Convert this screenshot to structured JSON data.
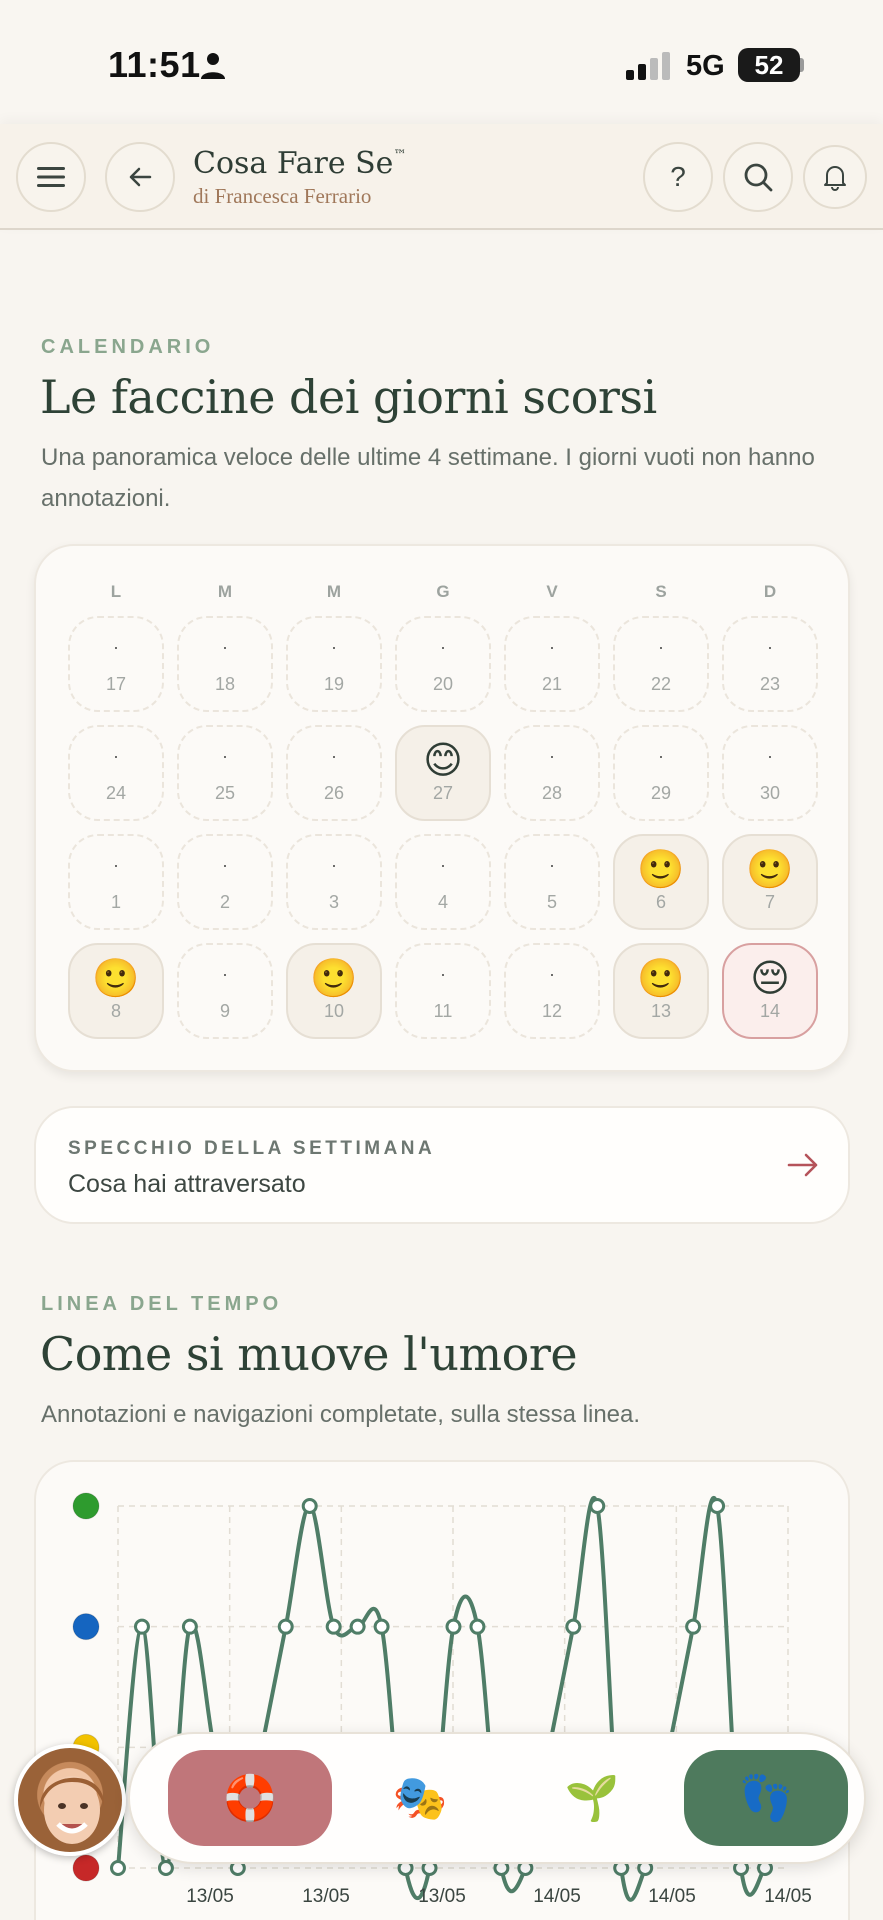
{
  "status_bar": {
    "time": "11:51",
    "network": "5G",
    "battery": "52"
  },
  "header": {
    "title": "Cosa Fare Se",
    "trademark": "™",
    "subtitle": "di Francesca Ferrario",
    "help_label": "?"
  },
  "calendar": {
    "eyebrow": "CALENDARIO",
    "title": "Le faccine dei giorni scorsi",
    "description": "Una panoramica veloce delle ultime 4 settimane. I giorni vuoti non hanno annotazioni.",
    "weekdays": [
      "L",
      "M",
      "M",
      "G",
      "V",
      "S",
      "D"
    ],
    "weeks": [
      [
        {
          "day": "17",
          "mood": "·"
        },
        {
          "day": "18",
          "mood": "·"
        },
        {
          "day": "19",
          "mood": "·"
        },
        {
          "day": "20",
          "mood": "·"
        },
        {
          "day": "21",
          "mood": "·"
        },
        {
          "day": "22",
          "mood": "·"
        },
        {
          "day": "23",
          "mood": "·"
        }
      ],
      [
        {
          "day": "24",
          "mood": "·"
        },
        {
          "day": "25",
          "mood": "·"
        },
        {
          "day": "26",
          "mood": "·"
        },
        {
          "day": "27",
          "mood": "😊"
        },
        {
          "day": "28",
          "mood": "·"
        },
        {
          "day": "29",
          "mood": "·"
        },
        {
          "day": "30",
          "mood": "·"
        }
      ],
      [
        {
          "day": "1",
          "mood": "·"
        },
        {
          "day": "2",
          "mood": "·"
        },
        {
          "day": "3",
          "mood": "·"
        },
        {
          "day": "4",
          "mood": "·"
        },
        {
          "day": "5",
          "mood": "·"
        },
        {
          "day": "6",
          "mood": "🙂"
        },
        {
          "day": "7",
          "mood": "🙂"
        }
      ],
      [
        {
          "day": "8",
          "mood": "🙂"
        },
        {
          "day": "9",
          "mood": "·"
        },
        {
          "day": "10",
          "mood": "🙂"
        },
        {
          "day": "11",
          "mood": "·"
        },
        {
          "day": "12",
          "mood": "·"
        },
        {
          "day": "13",
          "mood": "🙂"
        },
        {
          "day": "14",
          "mood": "😔"
        }
      ]
    ]
  },
  "mirror": {
    "eyebrow": "SPECCHIO DELLA SETTIMANA",
    "text": "Cosa hai attraversato"
  },
  "timeline": {
    "eyebrow": "LINEA DEL TEMPO",
    "title": "Come si muove l'umore",
    "description": "Annotazioni e navigazioni completate, sulla stessa linea."
  },
  "chart_data": {
    "type": "line",
    "y_levels": [
      {
        "level": 1,
        "color": "#c62828"
      },
      {
        "level": 2,
        "color": "#f2c200"
      },
      {
        "level": 3,
        "color": "#1565c0"
      },
      {
        "level": 4,
        "color": "#2e9b2e"
      }
    ],
    "ylim": [
      1,
      4
    ],
    "x_tick_labels": [
      "13/05",
      "13/05",
      "13/05",
      "14/05",
      "14/05",
      "14/05"
    ],
    "values": [
      1,
      3,
      1,
      3,
      2,
      1,
      2,
      3,
      4,
      3,
      3,
      3,
      1,
      1,
      3,
      3,
      1,
      1,
      2,
      3,
      4,
      1,
      1,
      2,
      3,
      4,
      1,
      1
    ],
    "line_color": "#4f7d67",
    "grid": true
  },
  "nav": {
    "items": [
      {
        "name": "lifebuoy",
        "icon": "🛟"
      },
      {
        "name": "theater",
        "icon": "🎭"
      },
      {
        "name": "seedling",
        "icon": "🌱"
      },
      {
        "name": "footprints",
        "icon": "👣"
      }
    ]
  }
}
